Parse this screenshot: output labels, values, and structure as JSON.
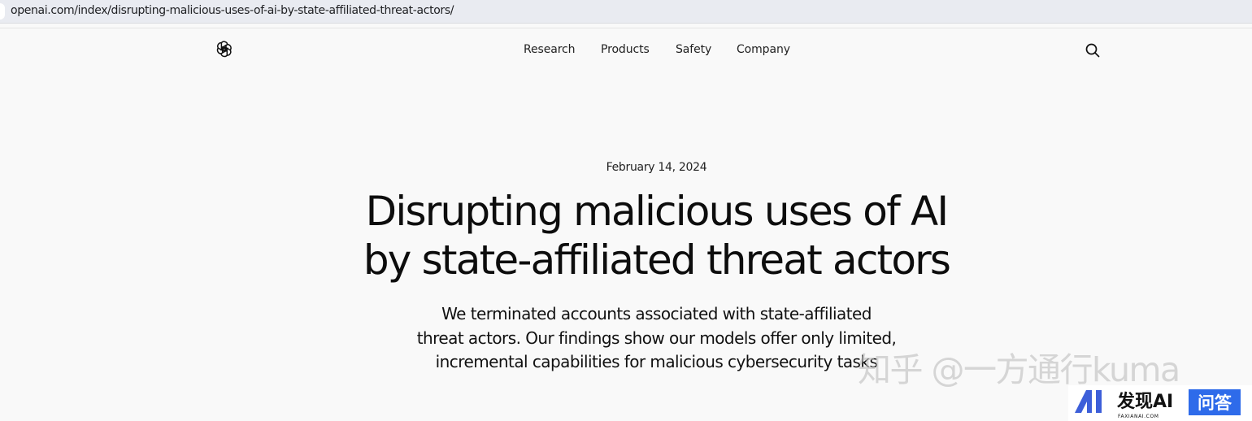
{
  "browser": {
    "url": "openai.com/index/disrupting-malicious-uses-of-ai-by-state-affiliated-threat-actors/"
  },
  "nav": {
    "logo_icon": "openai-logo-icon",
    "links": [
      "Research",
      "Products",
      "Safety",
      "Company"
    ],
    "search_icon": "search-icon"
  },
  "article": {
    "date": "February 14, 2024",
    "title_lines": [
      "Disrupting malicious uses of AI",
      "by state-affiliated threat actors"
    ],
    "summary_lines": [
      "We terminated accounts associated with state-affiliated",
      "threat actors. Our findings show our models offer only limited,",
      "incremental capabilities for malicious cybersecurity tasks"
    ]
  },
  "watermarks": {
    "zhihu": "知乎 @一方通行kuma",
    "badge_brand": "发现AI",
    "badge_domain": "FAXIANAI.COM",
    "badge_tag": "问答",
    "badge_logo_text": "AI",
    "badge_tag_color": "#2e6bea"
  }
}
